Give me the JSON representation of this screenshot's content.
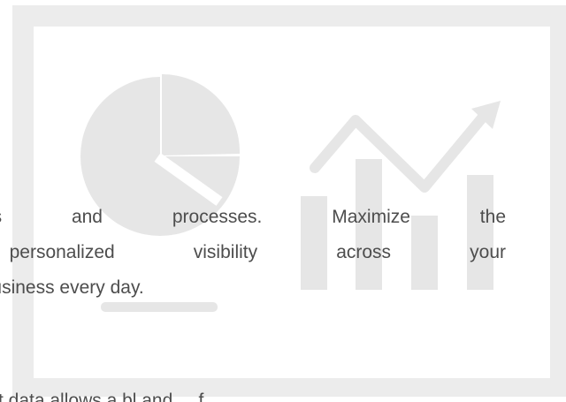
{
  "colors": {
    "frame": "#ececec",
    "screen": "#ffffff",
    "illustration": "#e6e6e6",
    "text": "#4d4d4d"
  },
  "illustration": {
    "icons": [
      "pie-chart-icon",
      "bar-chart-icon",
      "trend-arrow-icon"
    ]
  },
  "content": {
    "lines": [
      "operations and processes. Maximize the",
      "e,   personalized   visibility   across   your",
      "ove the business every day."
    ],
    "bottom_partial": "t  data  allows  a  bl  and  ...  f"
  }
}
